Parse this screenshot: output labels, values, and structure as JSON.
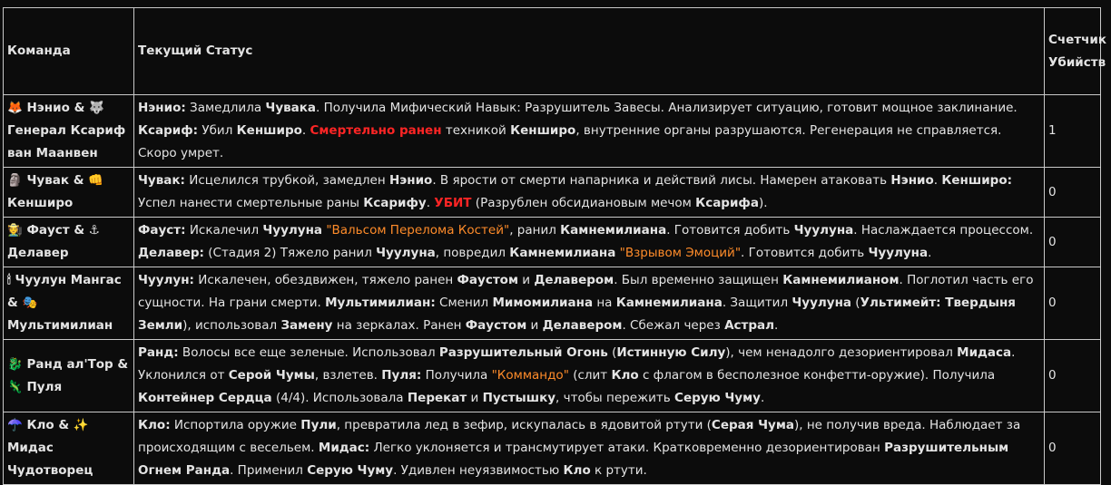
{
  "headers": {
    "team": "Команда",
    "status": "Текущий Статус",
    "kills": "Счетчик Убийств"
  },
  "rows": [
    {
      "team": [
        {
          "t": "🦊 Нэнио & 🐺 Генерал Ксариф ван Маанвен"
        }
      ],
      "status": [
        {
          "t": "Нэнио:",
          "s": "b"
        },
        {
          "t": " Замедлила "
        },
        {
          "t": "Чувака",
          "s": "b"
        },
        {
          "t": ". Получила Мифический Навык: Разрушитель Завесы. Анализирует ситуацию, готовит мощное заклинание. "
        },
        {
          "t": "Ксариф:",
          "s": "b"
        },
        {
          "t": " Убил "
        },
        {
          "t": "Кенширо",
          "s": "b"
        },
        {
          "t": ". "
        },
        {
          "t": "Смертельно ранен",
          "s": "red"
        },
        {
          "t": " техникой "
        },
        {
          "t": "Кенширо",
          "s": "b"
        },
        {
          "t": ", внутренние органы разрушаются. Регенерация не справляется. Скоро умрет."
        }
      ],
      "kills": "1"
    },
    {
      "team": [
        {
          "t": "🗿 Чувак & 👊 Кенширо"
        }
      ],
      "status": [
        {
          "t": "Чувак:",
          "s": "b"
        },
        {
          "t": " Исцелился трубкой, замедлен "
        },
        {
          "t": "Нэнио",
          "s": "b"
        },
        {
          "t": ". В ярости от смерти напарника и действий лисы. Намерен атаковать "
        },
        {
          "t": "Нэнио",
          "s": "b"
        },
        {
          "t": ". "
        },
        {
          "t": "Кенширо:",
          "s": "b"
        },
        {
          "t": " Успел нанести смертельные раны "
        },
        {
          "t": "Ксарифу",
          "s": "b"
        },
        {
          "t": ". "
        },
        {
          "t": "УБИТ",
          "s": "red"
        },
        {
          "t": " (Разрублен обсидиановым мечом "
        },
        {
          "t": "Ксарифа",
          "s": "b"
        },
        {
          "t": ")."
        }
      ],
      "kills": "0"
    },
    {
      "team": [
        {
          "t": "🧑‍🌾 Фауст & ⚓ Делавер"
        }
      ],
      "status": [
        {
          "t": "Фауст:",
          "s": "b"
        },
        {
          "t": " Искалечил "
        },
        {
          "t": "Чуулуна",
          "s": "b"
        },
        {
          "t": " "
        },
        {
          "t": "\"Вальсом Перелома Костей\"",
          "s": "orange"
        },
        {
          "t": ", ранил "
        },
        {
          "t": "Камнемилиана",
          "s": "b"
        },
        {
          "t": ". Готовится добить "
        },
        {
          "t": "Чуулуна",
          "s": "b"
        },
        {
          "t": ". Наслаждается процессом. "
        },
        {
          "t": "Делавер:",
          "s": "b"
        },
        {
          "t": " (Стадия 2) Тяжело ранил "
        },
        {
          "t": "Чуулуна",
          "s": "b"
        },
        {
          "t": ", повредил "
        },
        {
          "t": "Камнемилиана",
          "s": "b"
        },
        {
          "t": " "
        },
        {
          "t": "\"Взрывом Эмоций\"",
          "s": "orange"
        },
        {
          "t": ". Готовится добить "
        },
        {
          "t": "Чуулуна",
          "s": "b"
        },
        {
          "t": "."
        }
      ],
      "kills": "0"
    },
    {
      "team": [
        {
          "t": "🕯 Чуулун Мангас & 🎭 Мультимилиан"
        }
      ],
      "status": [
        {
          "t": "Чуулун:",
          "s": "b"
        },
        {
          "t": " Искалечен, обездвижен, тяжело ранен "
        },
        {
          "t": "Фаустом",
          "s": "b"
        },
        {
          "t": " и "
        },
        {
          "t": "Делавером",
          "s": "b"
        },
        {
          "t": ". Был временно защищен "
        },
        {
          "t": "Камнемилианом",
          "s": "b"
        },
        {
          "t": ". Поглотил часть его сущности. На грани смерти. "
        },
        {
          "t": "Мультимилиан:",
          "s": "b"
        },
        {
          "t": " Сменил "
        },
        {
          "t": "Мимомилиана",
          "s": "b"
        },
        {
          "t": " на "
        },
        {
          "t": "Камнемилиана",
          "s": "b"
        },
        {
          "t": ". Защитил "
        },
        {
          "t": "Чуулуна",
          "s": "b"
        },
        {
          "t": " ("
        },
        {
          "t": "Ультимейт: Твердыня Земли",
          "s": "b"
        },
        {
          "t": "), использовал "
        },
        {
          "t": "Замену",
          "s": "b"
        },
        {
          "t": " на зеркалах. Ранен "
        },
        {
          "t": "Фаустом",
          "s": "b"
        },
        {
          "t": " и "
        },
        {
          "t": "Делавером",
          "s": "b"
        },
        {
          "t": ". Сбежал через "
        },
        {
          "t": "Астрал",
          "s": "b"
        },
        {
          "t": "."
        }
      ],
      "kills": "0"
    },
    {
      "team": [
        {
          "t": "🐉 Ранд ал'Тор & 🦎 Пуля"
        }
      ],
      "status": [
        {
          "t": "Ранд:",
          "s": "b"
        },
        {
          "t": " Волосы все еще зеленые. Использовал "
        },
        {
          "t": "Разрушительный Огонь",
          "s": "b"
        },
        {
          "t": " ("
        },
        {
          "t": "Истинную Силу",
          "s": "b"
        },
        {
          "t": "), чем ненадолго дезориентировал "
        },
        {
          "t": "Мидаса",
          "s": "b"
        },
        {
          "t": ". Уклонился от "
        },
        {
          "t": "Серой Чумы",
          "s": "b"
        },
        {
          "t": ", взлетев. "
        },
        {
          "t": "Пуля:",
          "s": "b"
        },
        {
          "t": " Получила "
        },
        {
          "t": "\"Коммандо\"",
          "s": "orange"
        },
        {
          "t": " (слит "
        },
        {
          "t": "Кло",
          "s": "b"
        },
        {
          "t": " с флагом в бесполезное конфетти-оружие). Получила "
        },
        {
          "t": "Контейнер Сердца",
          "s": "b"
        },
        {
          "t": " (4/4). Использовала "
        },
        {
          "t": "Перекат",
          "s": "b"
        },
        {
          "t": " и "
        },
        {
          "t": "Пустышку",
          "s": "b"
        },
        {
          "t": ", чтобы пережить "
        },
        {
          "t": "Серую Чуму",
          "s": "b"
        },
        {
          "t": "."
        }
      ],
      "kills": "0"
    },
    {
      "team": [
        {
          "t": "☂️ Кло & ✨ Мидас Чудотворец"
        }
      ],
      "status": [
        {
          "t": "Кло:",
          "s": "b"
        },
        {
          "t": " Испортила оружие "
        },
        {
          "t": "Пули",
          "s": "b"
        },
        {
          "t": ", превратила лед в зефир, искупалась в ядовитой ртути ("
        },
        {
          "t": "Серая Чума",
          "s": "b"
        },
        {
          "t": "), не получив вреда. Наблюдает за происходящим с весельем. "
        },
        {
          "t": "Мидас:",
          "s": "b"
        },
        {
          "t": " Легко уклоняется и трансмутирует атаки. Кратковременно дезориентирован "
        },
        {
          "t": "Разрушительным Огнем Ранда",
          "s": "b"
        },
        {
          "t": ". Применил "
        },
        {
          "t": "Серую Чуму",
          "s": "b"
        },
        {
          "t": ". Удивлен неуязвимостью "
        },
        {
          "t": "Кло",
          "s": "b"
        },
        {
          "t": " к ртути."
        }
      ],
      "kills": "0"
    }
  ]
}
